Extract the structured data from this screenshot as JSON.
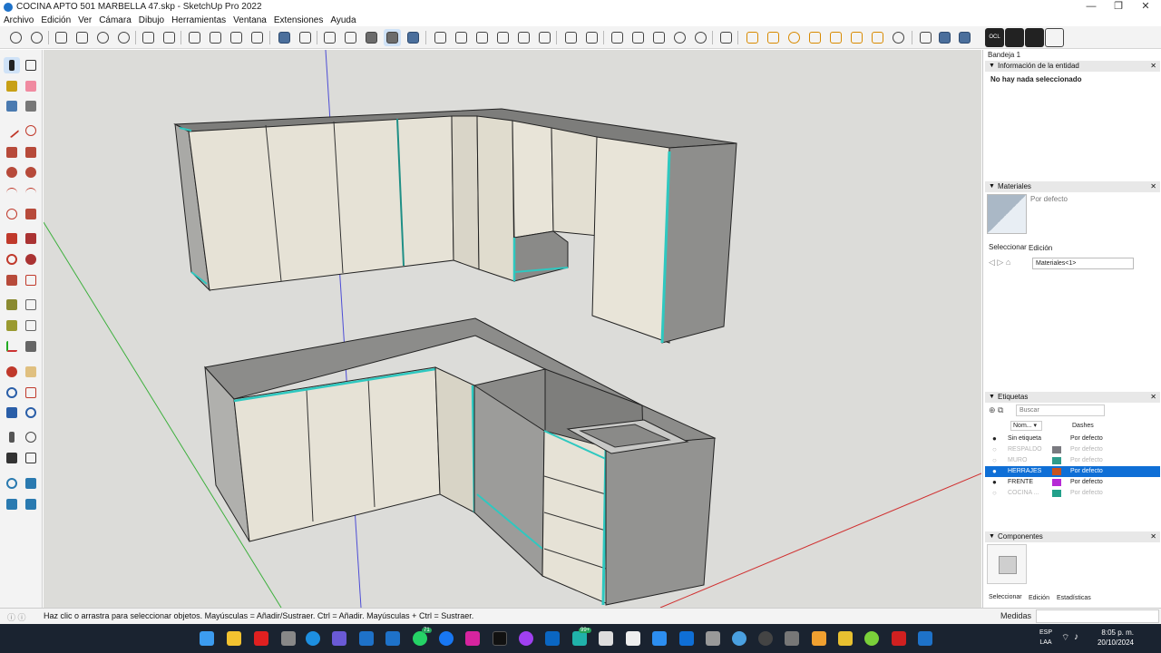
{
  "window": {
    "title": "COCINA APTO 501 MARBELLA 47.skp - SketchUp Pro 2022",
    "minimize": "—",
    "maximize": "❐",
    "close": "✕"
  },
  "menu": [
    "Archivo",
    "Edición",
    "Ver",
    "Cámara",
    "Dibujo",
    "Herramientas",
    "Ventana",
    "Extensiones",
    "Ayuda"
  ],
  "toolbar": {
    "extension_label": "OCL"
  },
  "tray": {
    "title": "Bandeja 1",
    "entity_info": {
      "header": "Información de la entidad",
      "message": "No hay nada seleccionado"
    },
    "materials": {
      "header": "Materiales",
      "current": "Por defecto",
      "tab_select": "Seleccionar",
      "tab_edit": "Edición",
      "library": "Materiales<1>"
    },
    "tags": {
      "header": "Etiquetas",
      "search_placeholder": "Buscar",
      "col_name": "Nom... ▾",
      "col_dashes": "Dashes",
      "rows": [
        {
          "name": "Sin etiqueta",
          "color": "",
          "dashes": "Por defecto",
          "visible": true,
          "selected": false
        },
        {
          "name": "RESPALDO",
          "color": "#7a7a80",
          "dashes": "Por defecto",
          "visible": false,
          "selected": false
        },
        {
          "name": "MURO",
          "color": "#2e9c8c",
          "dashes": "Por defecto",
          "visible": false,
          "selected": false
        },
        {
          "name": "HERRAJES",
          "color": "#c8531f",
          "dashes": "Por defecto",
          "visible": true,
          "selected": true
        },
        {
          "name": "FRENTE",
          "color": "#b62ad6",
          "dashes": "Por defecto",
          "visible": true,
          "selected": false
        },
        {
          "name": "COCINA ...",
          "color": "#22a08a",
          "dashes": "Por defecto",
          "visible": false,
          "selected": false
        }
      ]
    },
    "components": {
      "header": "Componentes",
      "tab_select": "Seleccionar",
      "tab_edit": "Edición",
      "tab_stats": "Estadísticas"
    }
  },
  "statusbar": {
    "message": "Haz clic o arrastra para seleccionar objetos. Mayúsculas = Añadir/Sustraer. Ctrl = Añadir. Mayúsculas + Ctrl = Sustraer.",
    "measurements_label": "Medidas"
  },
  "taskbar": {
    "badge_whatsapp": "71",
    "badge_chat": "99+",
    "lang": "ESP",
    "lang_sub": "LAA",
    "time": "8:05 p. m.",
    "date": "20/10/2024"
  },
  "colors": {
    "viewport_bg": "#dcdcd9",
    "cabinet_front": "#e6e2d6",
    "cabinet_side": "#8e8e8c",
    "edge_highlight": "#2ec8c0",
    "selection_blue": "#0f6fd6"
  }
}
